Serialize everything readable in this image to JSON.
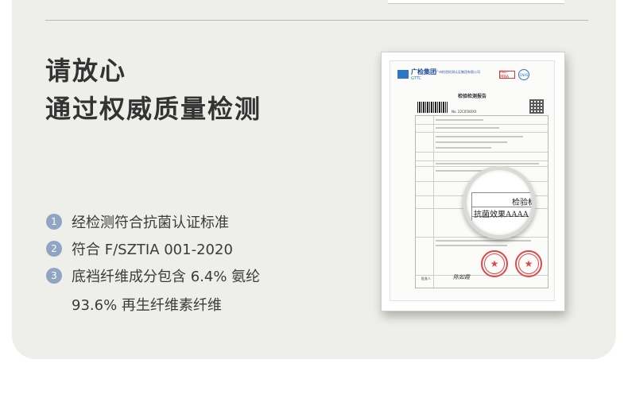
{
  "headline": {
    "line1": "请放心",
    "line2": "通过权威质量检测"
  },
  "features": [
    {
      "num": "1",
      "text": "经检测符合抗菌认证标准"
    },
    {
      "num": "2",
      "text": "符合 F/SZTIA 001-2020"
    },
    {
      "num": "3",
      "text": "底裆纤维成分包含 6.4% 氨纶"
    },
    {
      "num": "",
      "text": "93.6% 再生纤维素纤维"
    }
  ],
  "certificate": {
    "logo": "广检集团",
    "logo_sub": "GTTC",
    "org": "广州检验检测认证集团有限公司",
    "ilac_badge": "ilac-MRA",
    "cnas_badge": "CNAS",
    "doc_title": "检验检测报告",
    "report_no": "No. 22C0500XX",
    "mag_label": "检验标",
    "mag_text": "抗菌效果AAAAA级",
    "sign_label": "批准人",
    "signature": "陈如霞",
    "stamp_icon": "★"
  }
}
